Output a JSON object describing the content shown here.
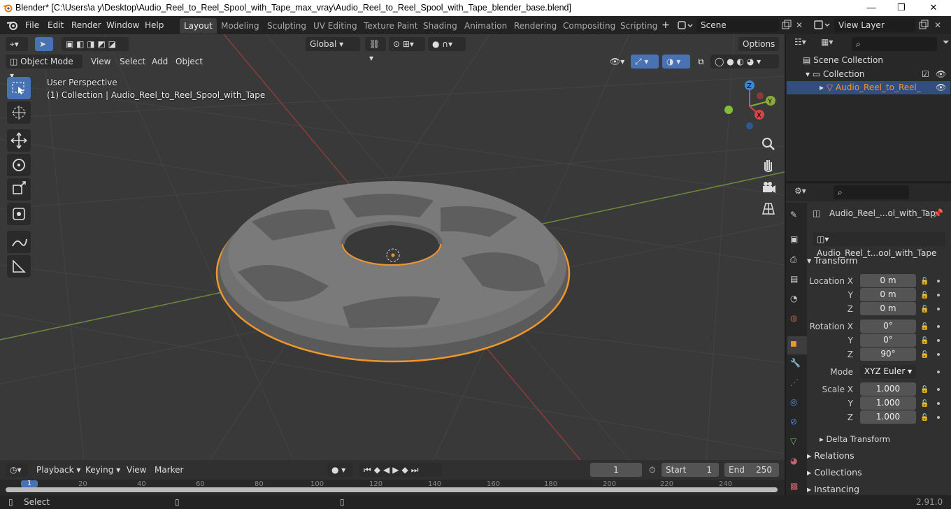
{
  "window": {
    "title": "Blender* [C:\\Users\\a y\\Desktop\\Audio_Reel_to_Reel_Spool_with_Tape_max_vray\\Audio_Reel_to_Reel_Spool_with_Tape_blender_base.blend]",
    "minimize": "—",
    "maximize": "❐",
    "close": "✕"
  },
  "menu": [
    "File",
    "Edit",
    "Render",
    "Window",
    "Help"
  ],
  "workspaces": [
    "Layout",
    "Modeling",
    "Sculpting",
    "UV Editing",
    "Texture Paint",
    "Shading",
    "Animation",
    "Rendering",
    "Compositing",
    "Scripting"
  ],
  "active_workspace": "Layout",
  "scene": {
    "label": "Scene"
  },
  "view_layer": {
    "label": "View Layer"
  },
  "viewport": {
    "transform_orientation": "Global",
    "options": "Options",
    "mode": "Object Mode",
    "menus": [
      "View",
      "Select",
      "Add",
      "Object"
    ],
    "overlay_line1": "User Perspective",
    "overlay_line2": "(1) Collection | Audio_Reel_to_Reel_Spool_with_Tape",
    "gizmo": {
      "z": "Z",
      "y": "Y",
      "x": "X"
    }
  },
  "outliner": {
    "scene_collection": "Scene Collection",
    "collection": "Collection",
    "object": "Audio_Reel_to_Reel_"
  },
  "properties": {
    "object_name": "Audio_Reel_...ol_with_Tap",
    "data_name": "Audio_Reel_t...ool_with_Tape",
    "transform": "Transform",
    "location": {
      "label": "Location X",
      "x": "0 m",
      "y": "0 m",
      "z": "0 m"
    },
    "rotation": {
      "label": "Rotation X",
      "x": "0°",
      "y": "0°",
      "z": "90°"
    },
    "mode_label": "Mode",
    "mode": "XYZ Euler",
    "scale": {
      "label": "Scale X",
      "x": "1.000",
      "y": "1.000",
      "z": "1.000"
    },
    "axis_y": "Y",
    "axis_z": "Z",
    "delta": "Delta Transform",
    "relations": "Relations",
    "collections": "Collections",
    "instancing": "Instancing"
  },
  "timeline": {
    "menus": [
      "Playback",
      "Keying",
      "View",
      "Marker"
    ],
    "frame": "1",
    "start_label": "Start",
    "start": "1",
    "end_label": "End",
    "end": "250",
    "ticks": [
      "1",
      "20",
      "40",
      "60",
      "80",
      "100",
      "120",
      "140",
      "160",
      "180",
      "200",
      "220",
      "240"
    ]
  },
  "status": {
    "select": "Select",
    "version": "2.91.0"
  }
}
